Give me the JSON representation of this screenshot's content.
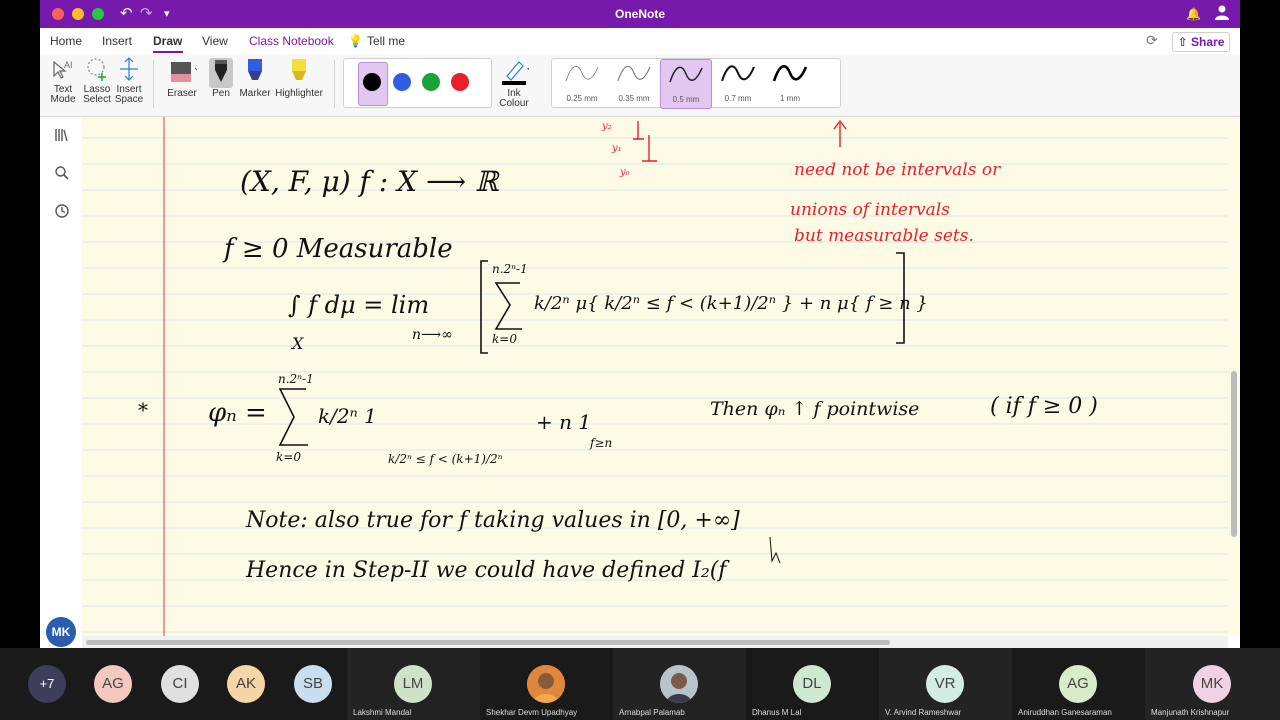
{
  "window": {
    "title": "OneNote"
  },
  "menu": {
    "tabs": [
      "Home",
      "Insert",
      "Draw",
      "View",
      "Class Notebook"
    ],
    "tell_me": "Tell me",
    "share": "Share"
  },
  "ribbon": {
    "text_mode": [
      "Text",
      "Mode"
    ],
    "lasso_select": [
      "Lasso",
      "Select"
    ],
    "insert_space": [
      "Insert",
      "Space"
    ],
    "eraser": "Eraser",
    "pen": "Pen",
    "marker": "Marker",
    "highlighter": "Highlighter",
    "ink_colour": [
      "Ink",
      "Colour"
    ],
    "pen_colors": [
      "#000000",
      "#2f5fe0",
      "#1aa33a",
      "#e8202a"
    ],
    "thicknesses": [
      "0.25 mm",
      "0.35 mm",
      "0.5 mm",
      "0.7 mm",
      "1 mm"
    ],
    "selected_thickness": "0.5 mm"
  },
  "user": {
    "initials": "MK"
  },
  "notes": {
    "line1": "(X, F, μ)     f : X ⟶ ℝ",
    "line2": "f ≥ 0  Measurable",
    "integral_lhs": "∫ f dμ  =  lim",
    "integral_sub": "X",
    "lim_sub": "n⟶∞",
    "sum_top": "n.2ⁿ-1",
    "sum_bottom": "k=0",
    "integral_rhs": "k/2ⁿ μ{ k/2ⁿ ≤ f < (k+1)/2ⁿ } + n μ{ f ≥ n }",
    "star": "*",
    "phi_def": "φₙ =",
    "phi_sum": "k/2ⁿ 1",
    "phi_sub": "k/2ⁿ ≤ f < (k+1)/2ⁿ",
    "phi_tail": "+ n 1",
    "phi_tail_sub": "f≥n",
    "then": "Then  φₙ ↑ f  pointwise",
    "if_clause": "( if f ≥ 0 )",
    "note": "Note:  also true for  f taking values in   [0, +∞]",
    "hence": "Hence in  Step-II  we  could  have  defined  I₂(f",
    "red_note": [
      "need not be intervals or",
      "unions of intervals",
      "but measurable sets."
    ],
    "margin_labels": [
      "y₂",
      "y₁",
      "y₀"
    ]
  },
  "participants": [
    {
      "initials": "+7",
      "name": "",
      "color": "#3d3d5c"
    },
    {
      "initials": "AG",
      "name": "",
      "color": "#f4c7c0"
    },
    {
      "initials": "CI",
      "name": "",
      "color": "#e0e0e0"
    },
    {
      "initials": "AK",
      "name": "",
      "color": "#f5d6a8"
    },
    {
      "initials": "SB",
      "name": "",
      "color": "#c9dff0"
    },
    {
      "initials": "LM",
      "name": "Lakshmi Mandal",
      "color": "#cfe3c8"
    },
    {
      "initials": "",
      "name": "Shekhar Devm Upadhyay",
      "color": "#e0873c"
    },
    {
      "initials": "",
      "name": "Arnabpal Palamab",
      "color": "#7a5a48"
    },
    {
      "initials": "DL",
      "name": "Dhanus M Lal",
      "color": "#cfe9d0"
    },
    {
      "initials": "VR",
      "name": "V. Arvind Rameshwar",
      "color": "#d3ece4"
    },
    {
      "initials": "AG",
      "name": "Aniruddhan Ganesaraman",
      "color": "#d8ecc9"
    },
    {
      "initials": "MK",
      "name": "Manjunath Krishnapur",
      "color": "#f0d2e4"
    }
  ]
}
